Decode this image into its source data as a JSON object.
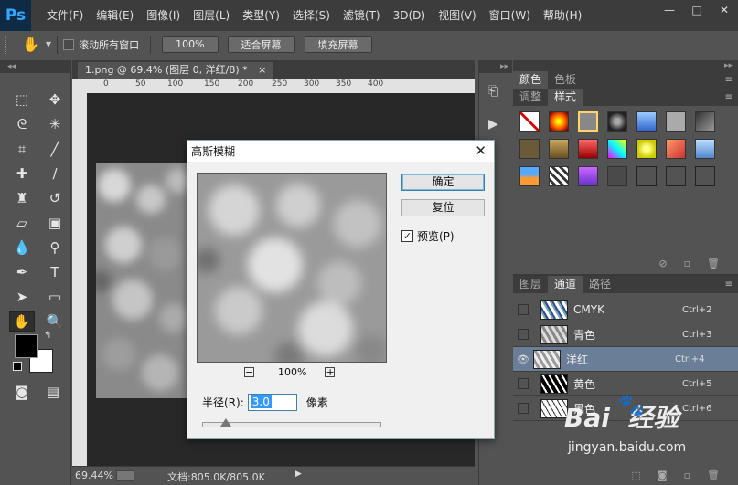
{
  "menubar": {
    "logo": "Ps",
    "items": [
      "文件(F)",
      "编辑(E)",
      "图像(I)",
      "图层(L)",
      "类型(Y)",
      "选择(S)",
      "滤镜(T)",
      "3D(D)",
      "视图(V)",
      "窗口(W)",
      "帮助(H)"
    ],
    "minimize": "—",
    "restore": "□",
    "close": "✕"
  },
  "options": {
    "scroll_all_label": "滚动所有窗口",
    "zoom_100": "100%",
    "fit_screen": "适合屏幕",
    "fill_screen": "填充屏幕"
  },
  "document": {
    "tab_title": "1.png @ 69.4% (图层 0, 洋红/8) *",
    "tab_close": "×",
    "ruler_ticks": [
      "0",
      "50",
      "100",
      "150",
      "200",
      "250",
      "300",
      "350",
      "400"
    ]
  },
  "status": {
    "zoom": "69.44%",
    "doc_size": "文档:805.0K/805.0K",
    "arrow": "▶"
  },
  "style_panel": {
    "tabs": [
      "颜色",
      "色板"
    ],
    "subtabs": [
      "调整",
      "样式"
    ]
  },
  "channel_panel": {
    "tabs": [
      "图层",
      "通道",
      "路径"
    ],
    "channels": [
      {
        "name": "CMYK",
        "shortcut": "Ctrl+2",
        "visible": false,
        "selected": false
      },
      {
        "name": "青色",
        "shortcut": "Ctrl+3",
        "visible": false,
        "selected": false
      },
      {
        "name": "洋红",
        "shortcut": "Ctrl+4",
        "visible": true,
        "selected": true
      },
      {
        "name": "黄色",
        "shortcut": "Ctrl+5",
        "visible": false,
        "selected": false
      },
      {
        "name": "黑色",
        "shortcut": "Ctrl+6",
        "visible": false,
        "selected": false
      }
    ]
  },
  "dialog": {
    "title": "高斯模糊",
    "close": "✕",
    "ok": "确定",
    "reset": "复位",
    "preview_label": "预览(P)",
    "preview_checked": true,
    "zoom_out": "−",
    "zoom_level": "100%",
    "zoom_in": "+",
    "radius_label": "半径(R):",
    "radius_value": "3.0",
    "radius_unit": "像素",
    "radius_slider_fraction": 0.13
  },
  "watermark": {
    "brand": "Bai  经验",
    "url": "jingyan.baidu.com"
  },
  "colors": {
    "accent": "#31a8ff",
    "selected_row": "#6a7f97",
    "panel_bg": "#535353",
    "dark_bg": "#3c3c3c"
  }
}
